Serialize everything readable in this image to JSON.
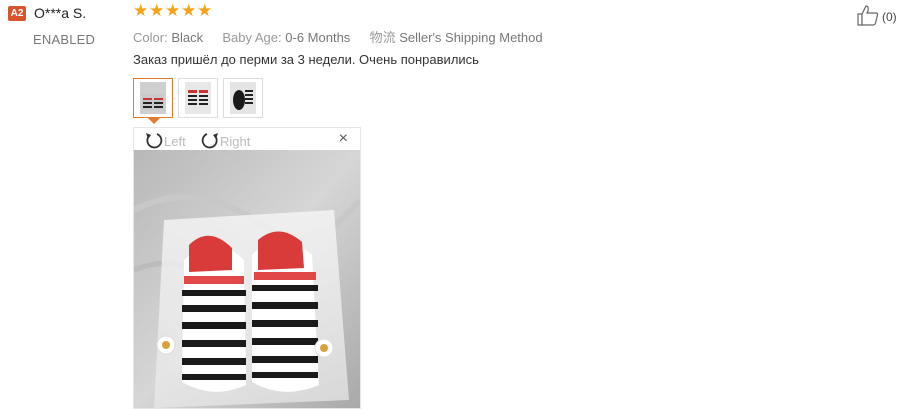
{
  "review": {
    "flag_code": "A2",
    "username": "O***a S.",
    "status": "ENABLED",
    "rating": 5,
    "stars": [
      "★",
      "★",
      "★",
      "★",
      "★"
    ],
    "attributes": [
      {
        "key": "Color:",
        "value": "Black"
      },
      {
        "key": "Baby Age:",
        "value": "0-6 Months"
      },
      {
        "key": "物流",
        "value": "Seller's Shipping Method"
      }
    ],
    "comment": "Заказ пришёл до перми за 3 недели. Очень понравились",
    "likes": "(0)"
  },
  "viewer": {
    "rotate_left_label": "Left",
    "rotate_right_label": "Right",
    "close_symbol": "×"
  },
  "colors": {
    "star": "#f7a21b",
    "flag": "#d9542c",
    "active_thumb_border": "#e37b2d"
  },
  "icons": {
    "rotate_left": "rotate-left-icon",
    "rotate_right": "rotate-right-icon",
    "like": "thumbs-up-icon",
    "close": "close-icon"
  }
}
